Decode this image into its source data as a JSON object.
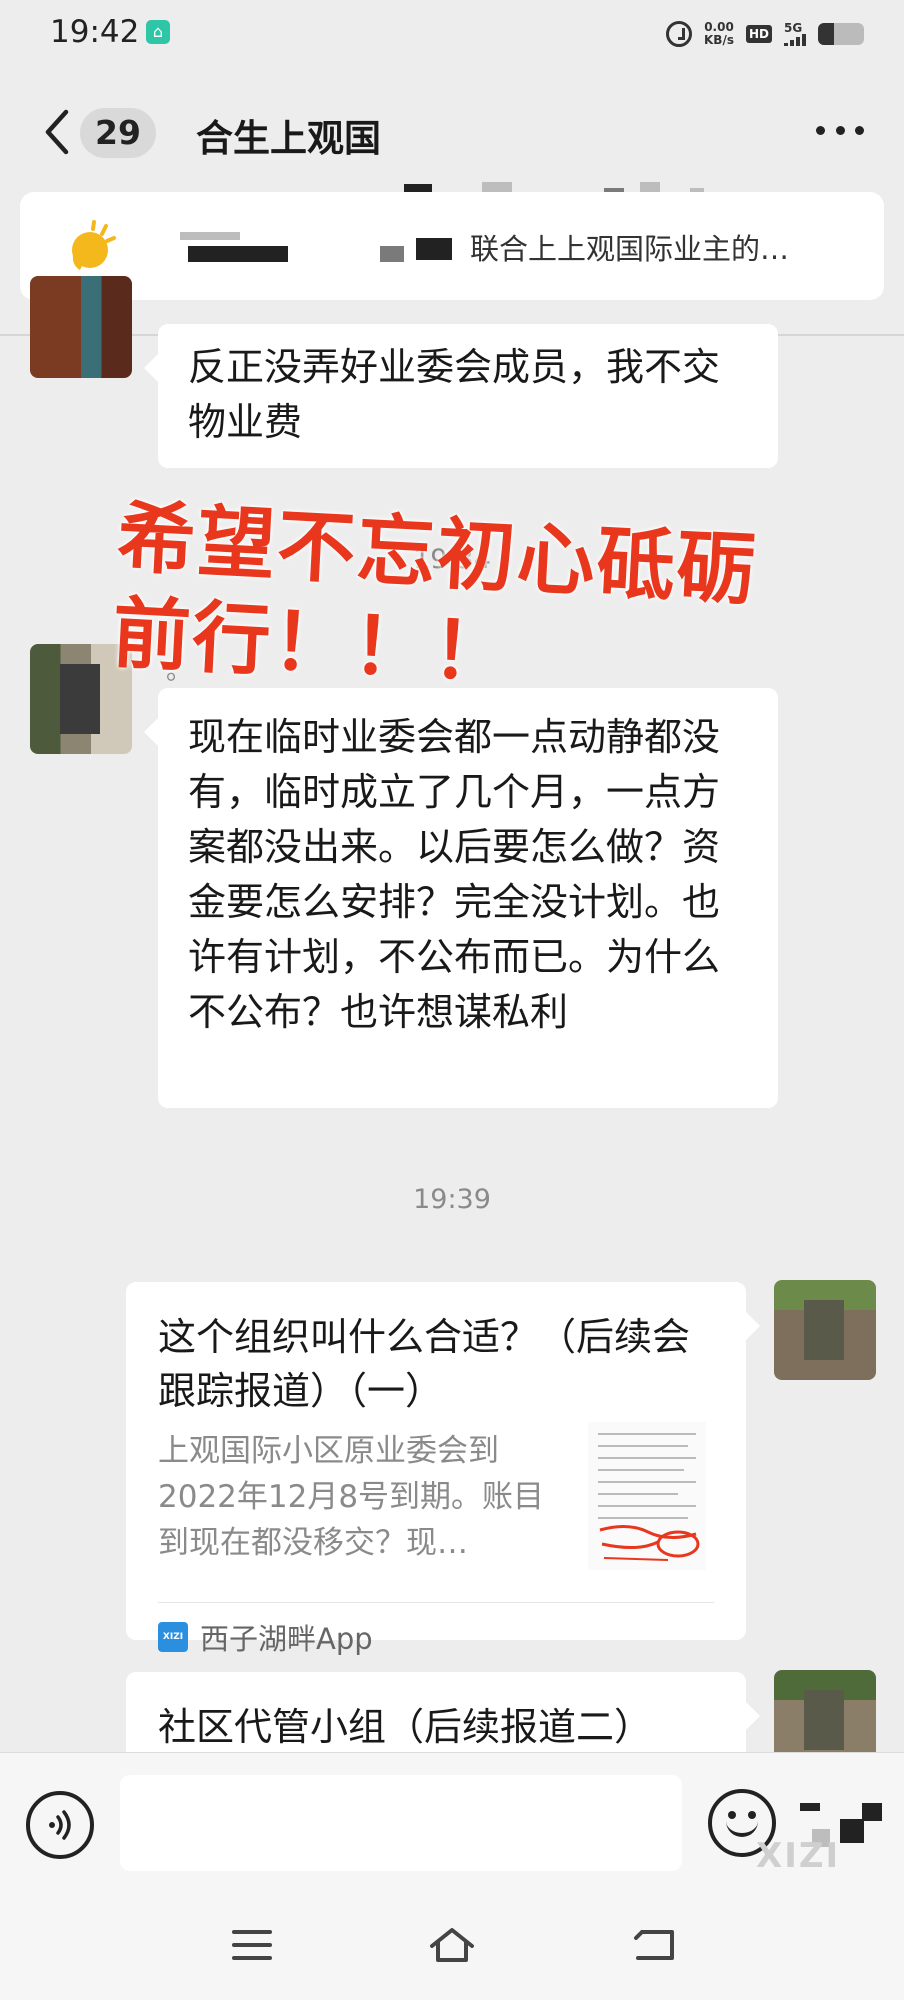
{
  "status_bar": {
    "time": "19:42",
    "net_speed_value": "0.00",
    "net_speed_unit": "KB/s",
    "hd_label": "HD",
    "signal_label": "5G"
  },
  "header": {
    "unread_count": "29",
    "title": "合生上观国"
  },
  "pinned": {
    "text": "联合上上观国际业主的…"
  },
  "messages": [
    {
      "text": "反正没弄好业委会成员，我不交物业费"
    },
    {
      "nickname": "。",
      "text": "现在临时业委会都一点动静都没有，临时成立了几个月，一点方案都没出来。以后要怎么做？资金要怎么安排？完全没计划。也许有计划，不公布而已。为什么不公布？也许想谋私利"
    }
  ],
  "timestamps": {
    "hidden": "19:34",
    "main": "19:39"
  },
  "overlay": {
    "text": "希望不忘初心砥砺前行！！！"
  },
  "cards": [
    {
      "title": "这个组织叫什么合适？（后续会跟踪报道）（一）",
      "description": "上观国际小区原业委会到2022年12月8号到期。账目到现在都没移交？现…",
      "source_logo": "XIZI",
      "source": "西子湖畔App"
    },
    {
      "title": "社区代管小组（后续报道二）"
    }
  ],
  "input": {
    "placeholder": "",
    "watermark": "XIZI"
  },
  "colors": {
    "background": "#ededed",
    "bubble": "#ffffff",
    "overlay_red": "#e8371d",
    "source_logo_blue": "#2b8fe0"
  },
  "icons": [
    "back-chevron-icon",
    "more-icon",
    "pinned-sun-icon",
    "voice-icon",
    "emoji-icon",
    "menu-icon",
    "home-icon",
    "back-icon"
  ]
}
